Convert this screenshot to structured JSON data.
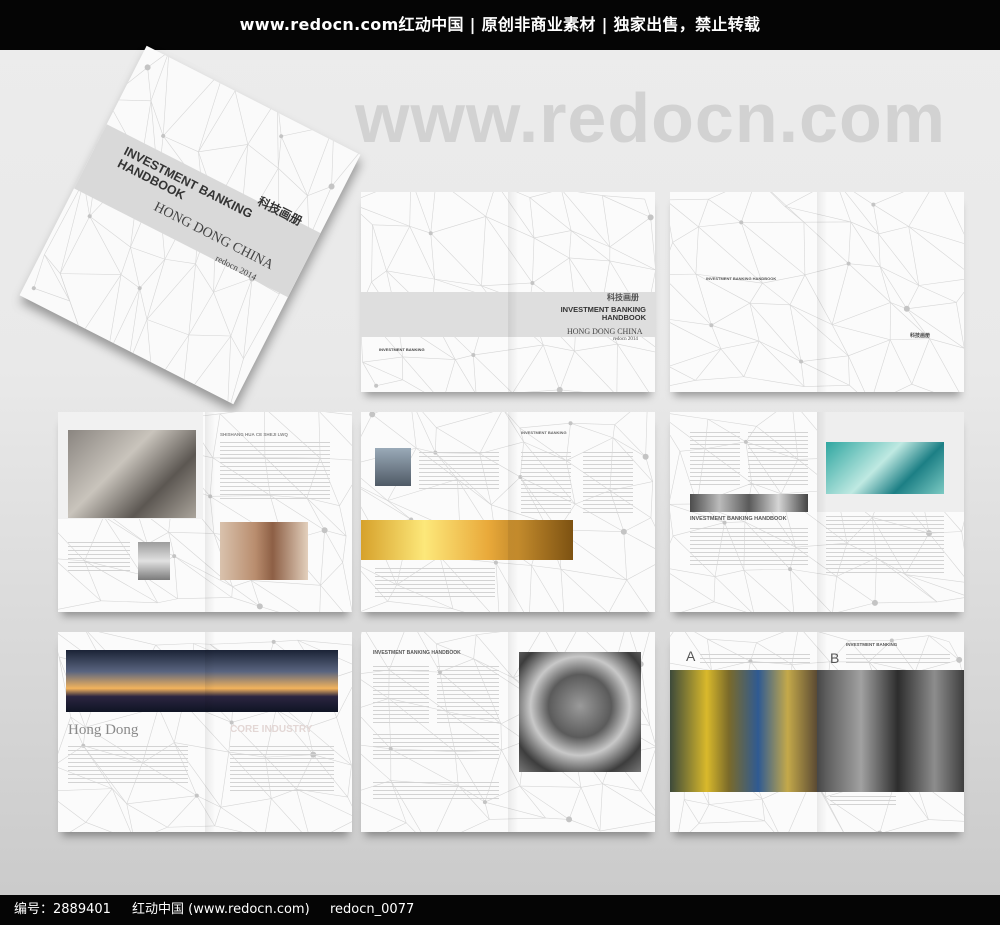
{
  "banner": {
    "text": "www.redocn.com红动中国 | 原创非商业素材 | 独家出售，禁止转载"
  },
  "watermark": {
    "text": "www.redocn.com"
  },
  "cover": {
    "title_cn": "科技画册",
    "title_en": "INVESTMENT BANKING HANDBOOK",
    "subtitle": "HONG DONG CHINA",
    "edition": "redocn 2014"
  },
  "spread1": {
    "title_cn": "科技画册",
    "title_en": "INVESTMENT BANKING HANDBOOK",
    "subtitle": "HONG DONG CHINA",
    "edition": "redocn 2014",
    "back_label": "INVESTMENT BANKING"
  },
  "spread2": {
    "label": "INVESTMENT BANKING HANDBOOK",
    "logo_cn": "科技画册"
  },
  "spread3": {
    "heading": "SHISHANG HUA CE SHEJI LWQ"
  },
  "spread4": {
    "heading": "INVESTMENT BANKING"
  },
  "spread5": {
    "heading": "INVESTMENT BANKING HANDBOOK"
  },
  "spread6": {
    "title": "Hong Dong",
    "core": "CORE INDUSTRY"
  },
  "spread7": {
    "heading": "INVESTMENT BANKING HANDBOOK"
  },
  "spread8": {
    "letter_a": "A",
    "letter_b": "B",
    "heading": "INVESTMENT BANKING"
  },
  "footer": {
    "id_label": "编号：2889401",
    "site": "红动中国 (www.redocn.com)",
    "author": "redocn_0077"
  },
  "colors": {
    "bar": "#050505",
    "page": "#fbfbfb",
    "band": "#d9d9d9",
    "line": "#d6d6d6"
  }
}
